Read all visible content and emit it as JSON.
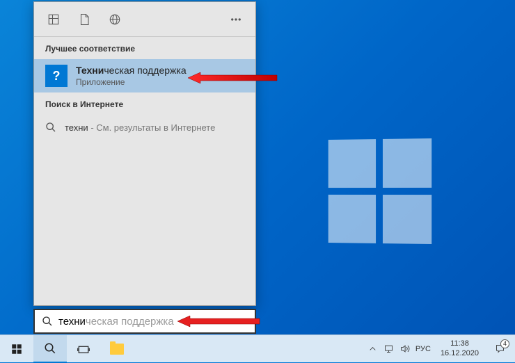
{
  "sections": {
    "best_match": "Лучшее соответствие",
    "web": "Поиск в Интернете"
  },
  "result": {
    "title_bold": "Техни",
    "title_rest": "ческая поддержка",
    "subtitle": "Приложение",
    "icon_char": "?"
  },
  "web_result": {
    "query": "техни",
    "suffix": " - См. результаты в Интернете"
  },
  "searchbox": {
    "typed": "техни",
    "ghost": "ческая поддержка"
  },
  "tray": {
    "lang": "РУС",
    "time": "11:38",
    "date": "16.12.2020",
    "notif_count": "4"
  }
}
